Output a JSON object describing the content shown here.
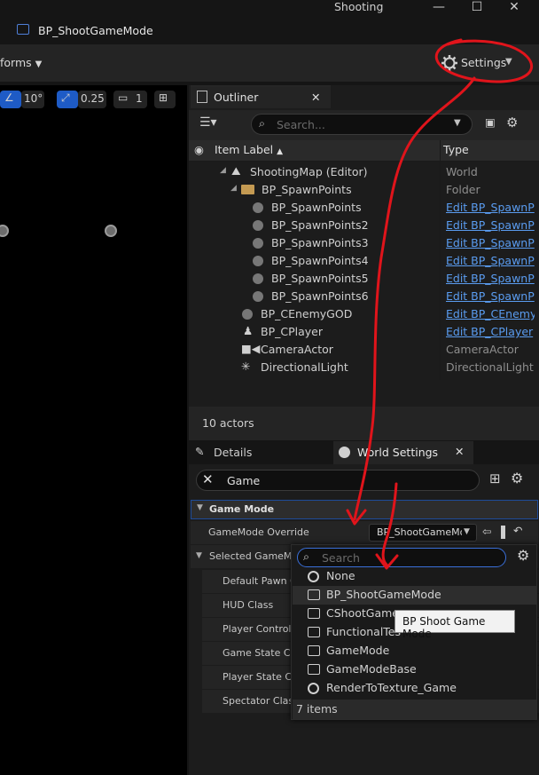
{
  "window": {
    "app_title": "Shooting",
    "minimize": "—",
    "maximize": "☐",
    "close": "✕"
  },
  "tab": {
    "title": "BP_ShootGameMode"
  },
  "toolbar": {
    "platforms_label": "forms",
    "settings_label": "Settings"
  },
  "viewport": {
    "rotation_snap": "10°",
    "scale_snap": "0.25",
    "camera_speed": "1"
  },
  "outliner": {
    "tab_label": "Outliner",
    "search_placeholder": "Search...",
    "col_item_label": "Item Label",
    "col_type": "Type",
    "rows": [
      {
        "label": "ShootingMap (Editor)",
        "type": "World",
        "icon": "map-icon",
        "link": false
      },
      {
        "label": "BP_SpawnPoints",
        "type": "Folder",
        "icon": "folder-icon",
        "link": false
      },
      {
        "label": "BP_SpawnPoints",
        "type": "Edit BP_SpawnP",
        "icon": "actor-icon",
        "link": true
      },
      {
        "label": "BP_SpawnPoints2",
        "type": "Edit BP_SpawnP",
        "icon": "actor-icon",
        "link": true
      },
      {
        "label": "BP_SpawnPoints3",
        "type": "Edit BP_SpawnP",
        "icon": "actor-icon",
        "link": true
      },
      {
        "label": "BP_SpawnPoints4",
        "type": "Edit BP_SpawnP",
        "icon": "actor-icon",
        "link": true
      },
      {
        "label": "BP_SpawnPoints5",
        "type": "Edit BP_SpawnP",
        "icon": "actor-icon",
        "link": true
      },
      {
        "label": "BP_SpawnPoints6",
        "type": "Edit BP_SpawnP",
        "icon": "actor-icon",
        "link": true
      },
      {
        "label": "BP_CEnemyGOD",
        "type": "Edit BP_CEnemy",
        "icon": "actor-icon",
        "link": true
      },
      {
        "label": "BP_CPlayer",
        "type": "Edit BP_CPlayer",
        "icon": "player-icon",
        "link": true
      },
      {
        "label": "CameraActor",
        "type": "CameraActor",
        "icon": "camera-icon",
        "link": false
      },
      {
        "label": "DirectionalLight",
        "type": "DirectionalLight",
        "icon": "light-icon",
        "link": false
      }
    ],
    "actor_count": "10 actors"
  },
  "details": {
    "details_tab": "Details",
    "world_settings_tab": "World Settings",
    "filter_value": "Game",
    "category_game_mode": "Game Mode",
    "gamemode_override_label": "GameMode Override",
    "gamemode_override_value": "BP_ShootGameMo",
    "selected_gamemode_label": "Selected GameMo",
    "sub_props": [
      "Default Pawn C",
      "HUD Class",
      "Player Controlle",
      "Game State Cla",
      "Player State Cl",
      "Spectator Clas"
    ]
  },
  "dropdown": {
    "search_placeholder": "Search",
    "items": [
      {
        "label": "None",
        "icon": "none-circle-icon"
      },
      {
        "label": "BP_ShootGameMode",
        "icon": "blueprint-icon"
      },
      {
        "label": "CShootGame",
        "icon": "blueprint-icon"
      },
      {
        "label": "FunctionalTes",
        "icon": "blueprint-icon"
      },
      {
        "label": "GameMode",
        "icon": "blueprint-icon"
      },
      {
        "label": "GameModeBase",
        "icon": "blueprint-icon"
      },
      {
        "label": "RenderToTexture_Game",
        "icon": "none-circle-icon"
      }
    ],
    "count": "7 items",
    "tooltip": "BP Shoot Game Mode"
  },
  "colors": {
    "accent": "#1e5bc6",
    "link": "#5a9cf0",
    "annotation": "#e0141b",
    "panel": "#1c1c1c"
  }
}
